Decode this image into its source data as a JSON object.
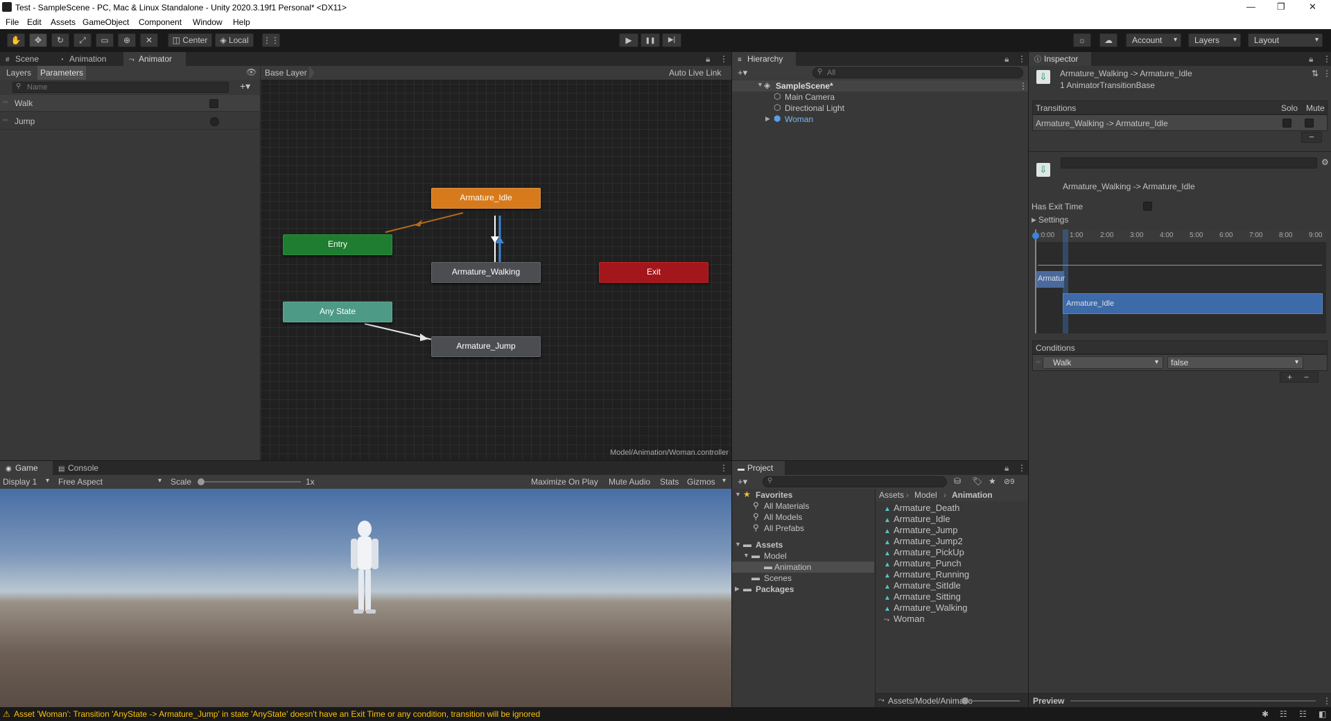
{
  "window": {
    "title": "Test - SampleScene - PC, Mac & Linux Standalone - Unity 2020.3.19f1 Personal* <DX11>",
    "controls": [
      "—",
      "❐",
      "✕"
    ]
  },
  "menu": [
    "File",
    "Edit",
    "Assets",
    "GameObject",
    "Component",
    "Window",
    "Help"
  ],
  "toolbar": {
    "center_label": "Center",
    "local_label": "Local",
    "account_label": "Account",
    "layers_label": "Layers",
    "layout_label": "Layout",
    "play": "▶",
    "pause": "❚❚",
    "step": "▶|"
  },
  "upper_left": {
    "tabs": [
      "Scene",
      "Animation",
      "Animator"
    ],
    "sub_tabs": [
      "Layers",
      "Parameters"
    ],
    "search_placeholder": "Name",
    "parameters": [
      {
        "name": "Walk",
        "kind": "bool"
      },
      {
        "name": "Jump",
        "kind": "trigger"
      }
    ],
    "breadcrumb": "Base Layer",
    "auto_live_link": "Auto Live Link",
    "footer_path": "Model/Animation/Woman.controller",
    "states": {
      "idle": "Armature_Idle",
      "entry": "Entry",
      "walking": "Armature_Walking",
      "exit": "Exit",
      "any_state": "Any State",
      "jump": "Armature_Jump"
    },
    "colors": {
      "idle": "#d77a1b",
      "entry": "#1e7d30",
      "exit": "#a3161b",
      "any_state": "#4d9a86",
      "default": "#4b4d51"
    }
  },
  "hierarchy": {
    "tab": "Hierarchy",
    "search_placeholder": "All",
    "scene": "SampleScene*",
    "items": [
      "Main Camera",
      "Directional Light",
      "Woman"
    ]
  },
  "inspector": {
    "tab": "Inspector",
    "title": "Armature_Walking -> Armature_Idle",
    "subtitle": "1 AnimatorTransitionBase",
    "transitions_label": "Transitions",
    "solo_label": "Solo",
    "mute_label": "Mute",
    "transition_row": "Armature_Walking -> Armature_Idle",
    "transition_name": "Armature_Walking -> Armature_Idle",
    "has_exit_time": "Has Exit Time",
    "settings_label": "Settings",
    "timeline_ticks": [
      ":0:00",
      "1:00",
      "2:00",
      "3:00",
      "4:00",
      "5:00",
      "6:00",
      "7:00",
      "8:00",
      "9:00"
    ],
    "source_clip": "Armatur",
    "dest_clip": "Armature_Idle",
    "conditions_label": "Conditions",
    "condition_param": "Walk",
    "condition_value": "false",
    "preview_label": "Preview"
  },
  "game": {
    "tabs": [
      "Game",
      "Console"
    ],
    "display": "Display 1",
    "aspect": "Free Aspect",
    "scale_label": "Scale",
    "scale_value": "1x",
    "buttons": [
      "Maximize On Play",
      "Mute Audio",
      "Stats",
      "Gizmos"
    ]
  },
  "project": {
    "tab": "Project",
    "hidden_count": "9",
    "tree": [
      {
        "label": "Favorites",
        "level": 0,
        "bold": true
      },
      {
        "label": "All Materials",
        "level": 1
      },
      {
        "label": "All Models",
        "level": 1
      },
      {
        "label": "All Prefabs",
        "level": 1
      },
      {
        "label": "Assets",
        "level": 0,
        "bold": true
      },
      {
        "label": "Model",
        "level": 1
      },
      {
        "label": "Animation",
        "level": 2,
        "selected": true
      },
      {
        "label": "Scenes",
        "level": 1
      },
      {
        "label": "Packages",
        "level": 0,
        "bold": true
      }
    ],
    "breadcrumb": [
      "Assets",
      "Model",
      "Animation"
    ],
    "files": [
      "Armature_Death",
      "Armature_Idle",
      "Armature_Jump",
      "Armature_Jump2",
      "Armature_PickUp",
      "Armature_Punch",
      "Armature_Running",
      "Armature_SitIdle",
      "Armature_Sitting",
      "Armature_Walking",
      "Woman"
    ],
    "footer_path": "Assets/Model/Animatio"
  },
  "status": {
    "message": "Asset 'Woman': Transition 'AnyState -> Armature_Jump' in state 'AnyState' doesn't have an Exit Time or any condition, transition will be ignored"
  }
}
